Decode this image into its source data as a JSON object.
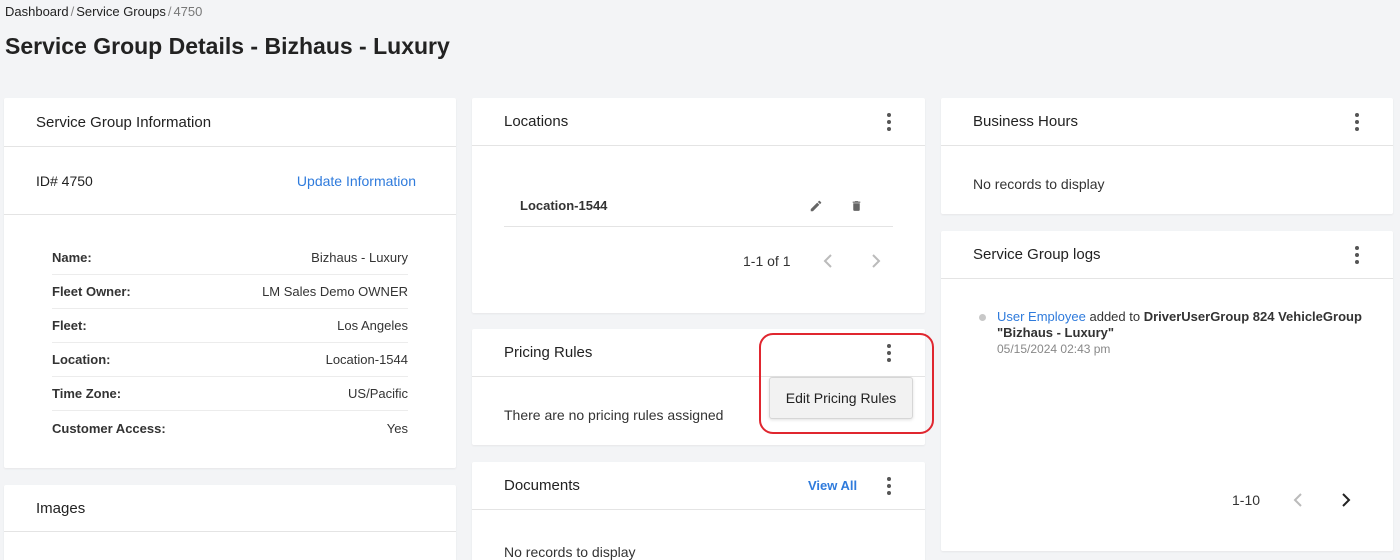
{
  "breadcrumb": {
    "items": [
      "Dashboard",
      "Service Groups"
    ],
    "current": "4750",
    "sep": "/"
  },
  "page_title": "Service Group Details - Bizhaus - Luxury",
  "info_card": {
    "title": "Service Group Information",
    "id_label": "ID# 4750",
    "update_link": "Update Information",
    "fields": [
      {
        "label": "Name:",
        "value": "Bizhaus - Luxury"
      },
      {
        "label": "Fleet Owner:",
        "value": "LM Sales Demo OWNER"
      },
      {
        "label": "Fleet:",
        "value": "Los Angeles"
      },
      {
        "label": "Location:",
        "value": "Location-1544"
      },
      {
        "label": "Time Zone:",
        "value": "US/Pacific"
      },
      {
        "label": "Customer Access:",
        "value": "Yes"
      }
    ]
  },
  "images_card": {
    "title": "Images"
  },
  "locations_card": {
    "title": "Locations",
    "row": "Location-1544",
    "pager_text": "1-1 of 1"
  },
  "pricing_card": {
    "title": "Pricing Rules",
    "empty_text": "There are no pricing rules assigned",
    "menu_item": "Edit Pricing Rules"
  },
  "documents_card": {
    "title": "Documents",
    "view_all": "View All",
    "empty_text": "No records to display"
  },
  "business_card": {
    "title": "Business Hours",
    "empty_text": "No records to display"
  },
  "logs_card": {
    "title": "Service Group logs",
    "log_user": "User Employee",
    "log_action": " added to ",
    "log_target": "DriverUserGroup 824 VehicleGroup \"Bizhaus - Luxury\"",
    "log_time": "05/15/2024 02:43 pm",
    "pager_text": "1-10"
  },
  "colors": {
    "link": "#2f7bdc",
    "highlight": "#e0262f",
    "background": "#f3f4f6"
  },
  "icons": [
    "pencil-icon",
    "trash-icon",
    "kebab-menu-icon",
    "chevron-left-icon",
    "chevron-right-icon"
  ]
}
